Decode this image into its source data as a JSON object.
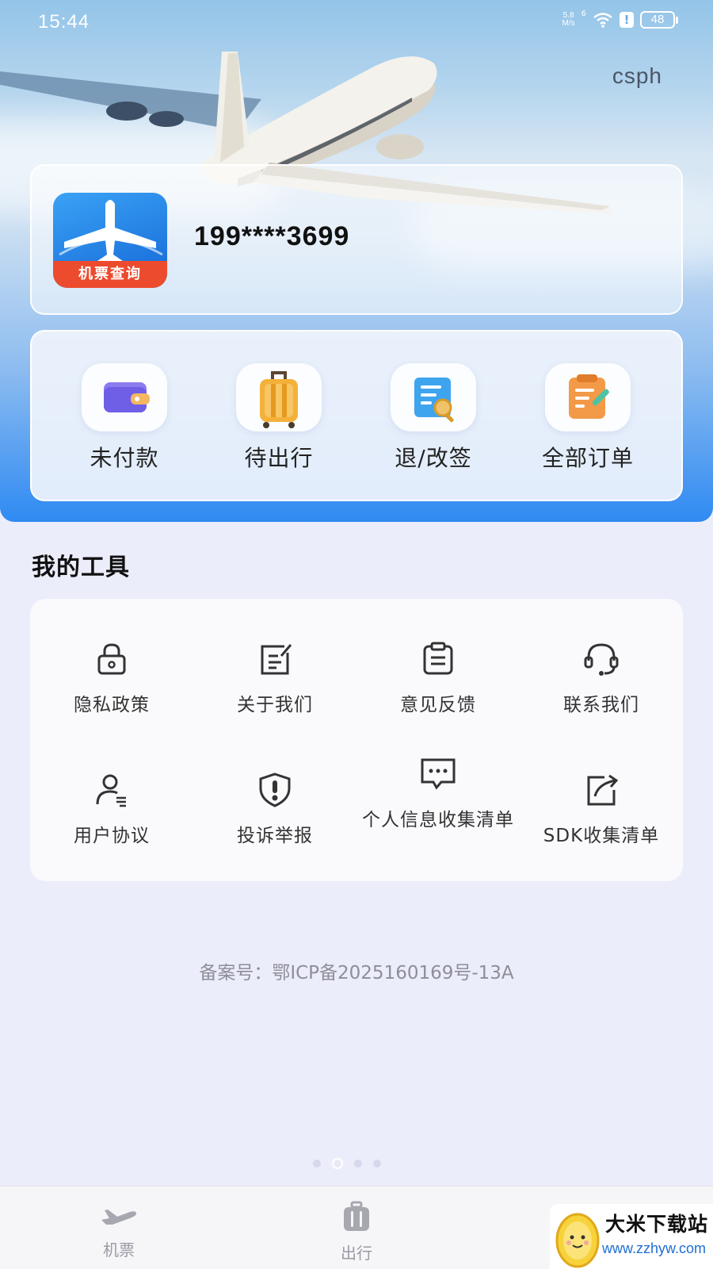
{
  "status_bar": {
    "time": "15:44",
    "net_speed_top": "5.8",
    "net_speed_bottom": "M/s",
    "signal_label": "6",
    "battery": "48"
  },
  "header": {
    "brand": "csph"
  },
  "profile": {
    "app_logo_label": "机票查询",
    "phone": "199****3699"
  },
  "orders": [
    {
      "label": "未付款",
      "icon": "wallet-icon"
    },
    {
      "label": "待出行",
      "icon": "luggage-icon"
    },
    {
      "label": "退/改签",
      "icon": "document-search-icon"
    },
    {
      "label": "全部订单",
      "icon": "order-list-icon"
    }
  ],
  "tools": {
    "title": "我的工具",
    "items": [
      {
        "label": "隐私政策",
        "icon": "lock-icon"
      },
      {
        "label": "关于我们",
        "icon": "edit-note-icon"
      },
      {
        "label": "意见反馈",
        "icon": "clipboard-icon"
      },
      {
        "label": "联系我们",
        "icon": "headset-icon"
      },
      {
        "label": "用户协议",
        "icon": "user-agreement-icon"
      },
      {
        "label": "投诉举报",
        "icon": "shield-alert-icon"
      },
      {
        "label": "个人信息收集清单",
        "icon": "message-dots-icon"
      },
      {
        "label": "SDK收集清单",
        "icon": "share-out-icon"
      }
    ]
  },
  "footer": {
    "icp": "备案号：鄂ICP备2025160169号-13A"
  },
  "tabbar": [
    {
      "label": "机票",
      "icon": "airplane-icon"
    },
    {
      "label": "出行",
      "icon": "suitcase-icon"
    }
  ],
  "watermark": {
    "title": "大米下载站",
    "url": "www.zzhyw.com"
  },
  "colors": {
    "accent": "#2f8af2",
    "background": "#ecedfb",
    "card": "#fafafd"
  }
}
